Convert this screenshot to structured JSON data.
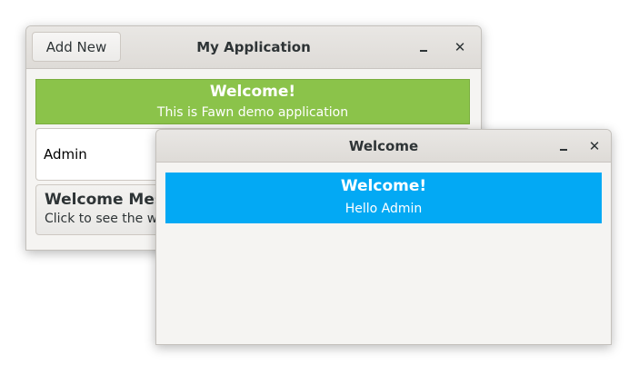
{
  "main_window": {
    "title": "My Application",
    "add_new_label": "Add New",
    "banner": {
      "title": "Welcome!",
      "subtitle": "This is Fawn demo application",
      "color": "#8bc34a"
    },
    "name_entry": {
      "value": "Admin"
    },
    "message_button": {
      "title": "Welcome Mes",
      "subtitle": "Click to see the w"
    }
  },
  "dialog_window": {
    "title": "Welcome",
    "banner": {
      "title": "Welcome!",
      "subtitle": "Hello Admin",
      "color": "#03a9f4"
    }
  },
  "icons": {
    "minimize": "minimize-icon",
    "close": "close-icon"
  }
}
